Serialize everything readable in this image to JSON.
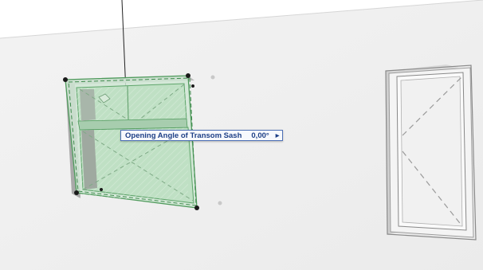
{
  "tracker": {
    "label": "Opening Angle of Transom Sash",
    "value": "0,00",
    "unit": "°",
    "menu_icon": "triangle-right-icon"
  },
  "colors": {
    "wall": "#f2f2f2",
    "selection_fill": "#bfe0c4",
    "selection_outline": "#4f9a5c",
    "tracker_border": "#4e71b6",
    "tracker_text": "#1d3f86",
    "handle": "#1a1a1a"
  }
}
